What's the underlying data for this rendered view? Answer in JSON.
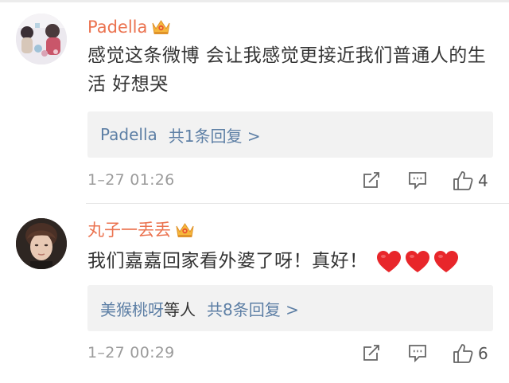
{
  "comments": [
    {
      "username": "Padella",
      "text": "感觉这条微博 会让我感觉更接近我们普通人的生活 好想哭",
      "reply_name": "Padella",
      "reply_summary": "共1条回复 >",
      "time": "1–27 01:26",
      "likes": "4",
      "icons": [
        "crown-badge-icon",
        "share-icon",
        "comment-icon",
        "like-icon"
      ]
    },
    {
      "username": "丸子一丢丢",
      "text": "我们嘉嘉回家看外婆了呀！真好！",
      "reply_name": "美猴桃呀",
      "reply_mid": "等人",
      "reply_summary": "共8条回复 >",
      "time": "1–27 00:29",
      "likes": "6",
      "icons": [
        "crown-badge-icon",
        "heart-icon",
        "share-icon",
        "comment-icon",
        "like-icon"
      ]
    }
  ],
  "colors": {
    "username": "#eb7350",
    "reply_link": "#5d7fa5",
    "heart": "#e8262a",
    "reply_bg": "#f2f2f2"
  }
}
